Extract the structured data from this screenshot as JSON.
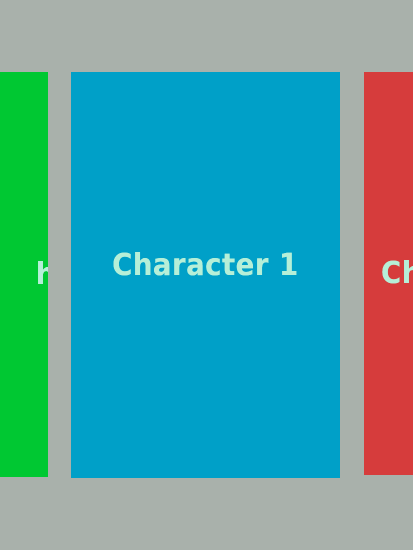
{
  "carousel": {
    "cards": [
      {
        "label": "Ch",
        "color": "#00c832",
        "position": "previous-partial",
        "visible_text": "h"
      },
      {
        "label": "Character 1",
        "color": "#00a0c8",
        "position": "current"
      },
      {
        "label": "Ch",
        "color": "#d63c3c",
        "position": "next-partial"
      }
    ]
  },
  "background_color": "#a9b1ab",
  "label_color": "#b6efd8"
}
